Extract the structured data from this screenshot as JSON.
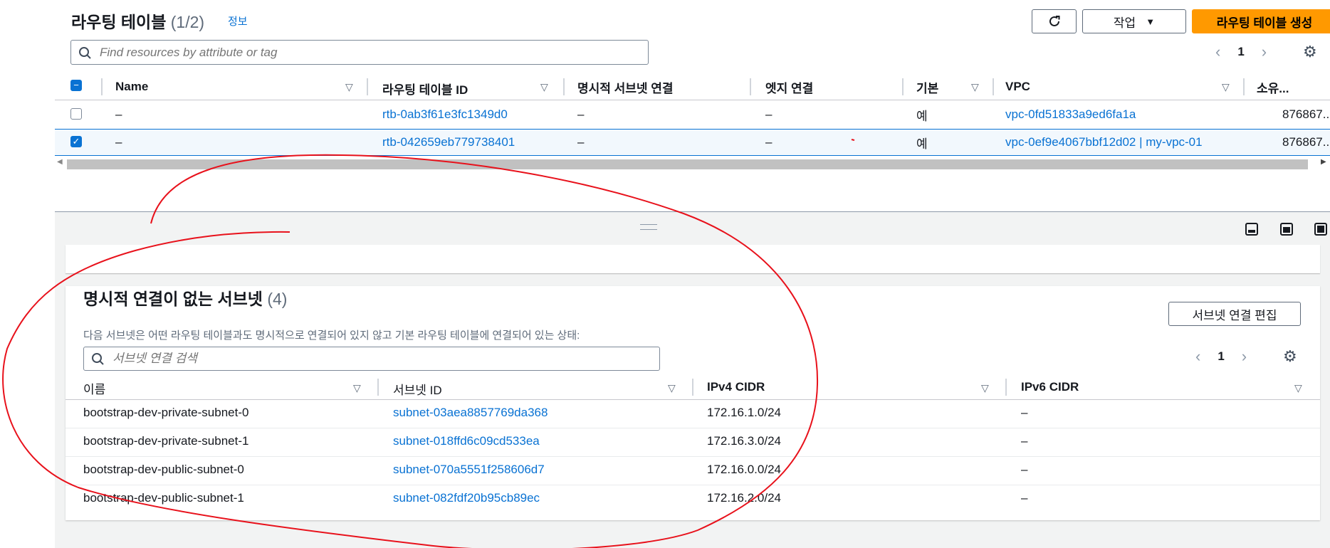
{
  "route_tables": {
    "title": "라우팅 테이블",
    "count": "(1/2)",
    "info_link": "정보",
    "actions_label": "작업",
    "create_label": "라우팅 테이블 생성",
    "search_placeholder": "Find resources by attribute or tag",
    "page": "1",
    "columns": [
      "Name",
      "라우팅 테이블 ID",
      "명시적 서브넷 연결",
      "엣지 연결",
      "기본",
      "VPC",
      "소유..."
    ],
    "rows": [
      {
        "name": "–",
        "id": "rtb-0ab3f61e3fc1349d0",
        "explicit": "–",
        "edge": "–",
        "main": "예",
        "vpc": "vpc-0fd51833a9ed6fa1a",
        "owner": "876867...",
        "selected": false
      },
      {
        "name": "–",
        "id": "rtb-042659eb779738401",
        "explicit": "–",
        "edge": "–",
        "main": "예",
        "vpc": "vpc-0ef9e4067bbf12d02 | my-vpc-01",
        "owner": "876867...",
        "selected": true
      }
    ]
  },
  "subnets_panel": {
    "title": "명시적 연결이 없는 서브넷",
    "count": "(4)",
    "description": "다음 서브넷은 어떤 라우팅 테이블과도 명시적으로 연결되어 있지 않고 기본 라우팅 테이블에 연결되어 있는 상태:",
    "edit_label": "서브넷 연결 편집",
    "search_placeholder": "서브넷 연결 검색",
    "page": "1",
    "columns": [
      "이름",
      "서브넷 ID",
      "IPv4 CIDR",
      "IPv6 CIDR"
    ],
    "rows": [
      {
        "name": "bootstrap-dev-private-subnet-0",
        "id": "subnet-03aea8857769da368",
        "ipv4": "172.16.1.0/24",
        "ipv6": "–"
      },
      {
        "name": "bootstrap-dev-private-subnet-1",
        "id": "subnet-018ffd6c09cd533ea",
        "ipv4": "172.16.3.0/24",
        "ipv6": "–"
      },
      {
        "name": "bootstrap-dev-public-subnet-0",
        "id": "subnet-070a5551f258606d7",
        "ipv4": "172.16.0.0/24",
        "ipv6": "–"
      },
      {
        "name": "bootstrap-dev-public-subnet-1",
        "id": "subnet-082fdf20b95cb89ec",
        "ipv4": "172.16.2.0/24",
        "ipv6": "–"
      }
    ]
  },
  "colors": {
    "primary": "#ff9900",
    "link": "#0972d3",
    "selected_row": "#f2f8fd",
    "annotation": "#e8111b"
  }
}
